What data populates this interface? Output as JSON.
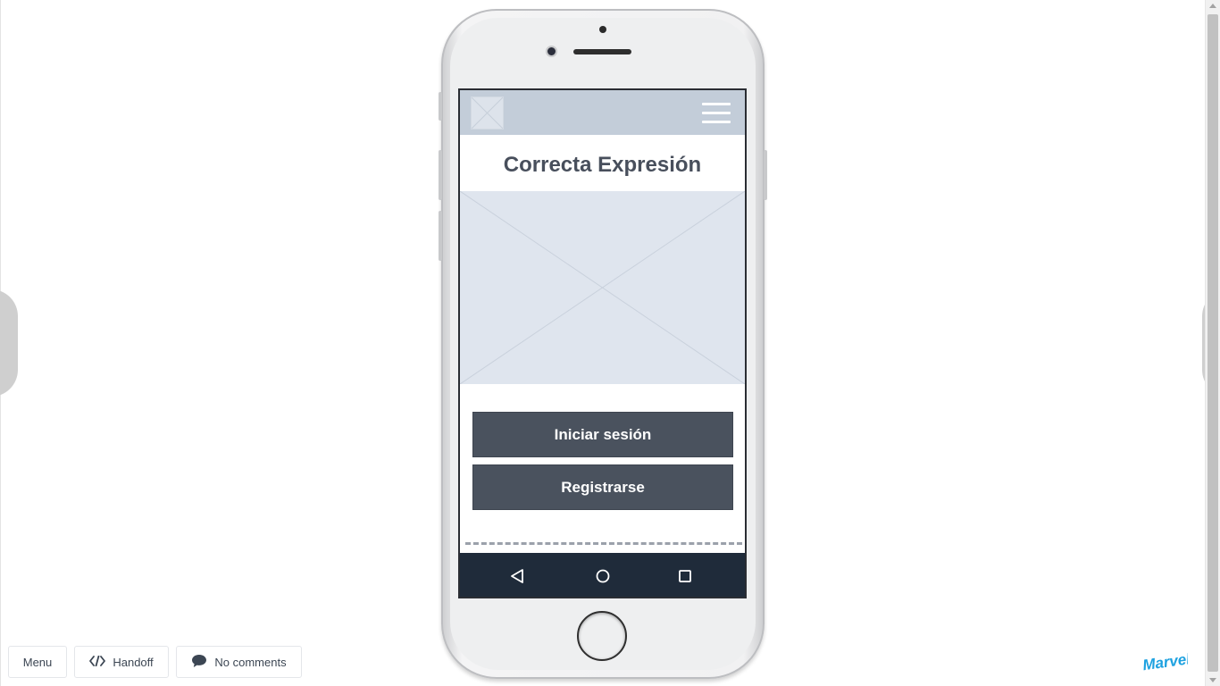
{
  "app": {
    "title": "Correcta Expresión"
  },
  "buttons": {
    "login": "Iniciar sesión",
    "register": "Registrarse"
  },
  "toolbar": {
    "menu_label": "Menu",
    "handoff_label": "Handoff",
    "comments_label": "No comments"
  },
  "branding": {
    "logo_text": "Marvel",
    "logo_color": "#1da1e0"
  },
  "icons": {
    "hamburger": "hamburger-menu-icon",
    "back": "android-back-icon",
    "home": "android-home-icon",
    "recents": "android-recents-icon",
    "code": "code-icon",
    "comment": "comment-bubble-icon"
  },
  "colors": {
    "app_bar": "#c3cdd9",
    "button": "#4a525e",
    "android_nav": "#1f2b3a",
    "placeholder": "#dfe5ee"
  }
}
